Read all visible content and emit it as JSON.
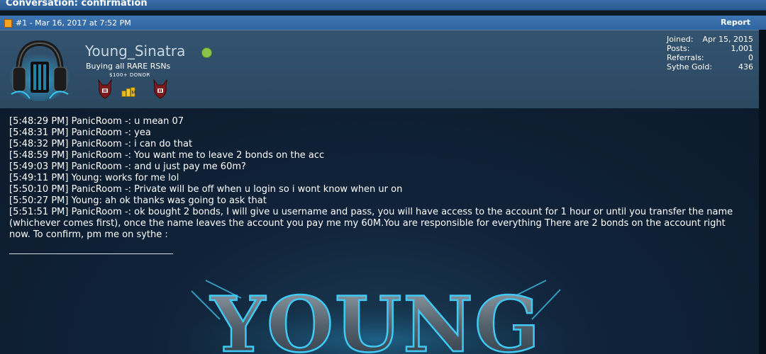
{
  "thread": {
    "title": "Conversation: confirmation"
  },
  "post": {
    "meta": "#1 - Mar 16, 2017 at 7:52 PM",
    "report_label": "Report",
    "user": {
      "username": "Young_Sinatra",
      "status": "online",
      "usertitle": "Buying all RARE RSNs",
      "donor_label": "$100+ DONOR",
      "badges": [
        "devil-badge",
        "gold-coins-badge",
        "devil-badge"
      ],
      "stats": [
        {
          "label": "Joined:",
          "value": "Apr 15, 2015"
        },
        {
          "label": "Posts:",
          "value": "1,001"
        },
        {
          "label": "Referrals:",
          "value": "0"
        },
        {
          "label": "Sythe Gold:",
          "value": "436"
        }
      ]
    },
    "messages": [
      "[5:48:29 PM] PanicRoom -: u mean 07",
      "[5:48:31 PM] PanicRoom -: yea",
      "[5:48:32 PM] PanicRoom -: i can do that",
      "[5:48:59 PM] PanicRoom -: You want me to leave 2 bonds on the acc",
      "[5:49:03 PM] PanicRoom -: and u just pay me 60m?",
      "[5:49:11 PM] Young: works for me lol",
      "[5:50:10 PM] PanicRoom -: Private will be off when u login so i wont know when ur on",
      "[5:50:27 PM] Young: ah ok thanks was going to ask that",
      "[5:51:51 PM] PanicRoom -: ok bought 2 bonds, I will give u username and pass, you will have access to the account for 1 hour or until you transfer the name (whichever comes first), once the name leaves the account you pay me my 60M.You are responsible for everything There are 2 bonds on the account right now. To confirm, pm me on sythe :"
    ],
    "signature": {
      "banner_text": "YOUNG"
    }
  },
  "colors": {
    "title_bar": "#2f64a0",
    "user_panel": "#2f4d67",
    "online": "#8bc34a",
    "background": "#0c1a26"
  }
}
